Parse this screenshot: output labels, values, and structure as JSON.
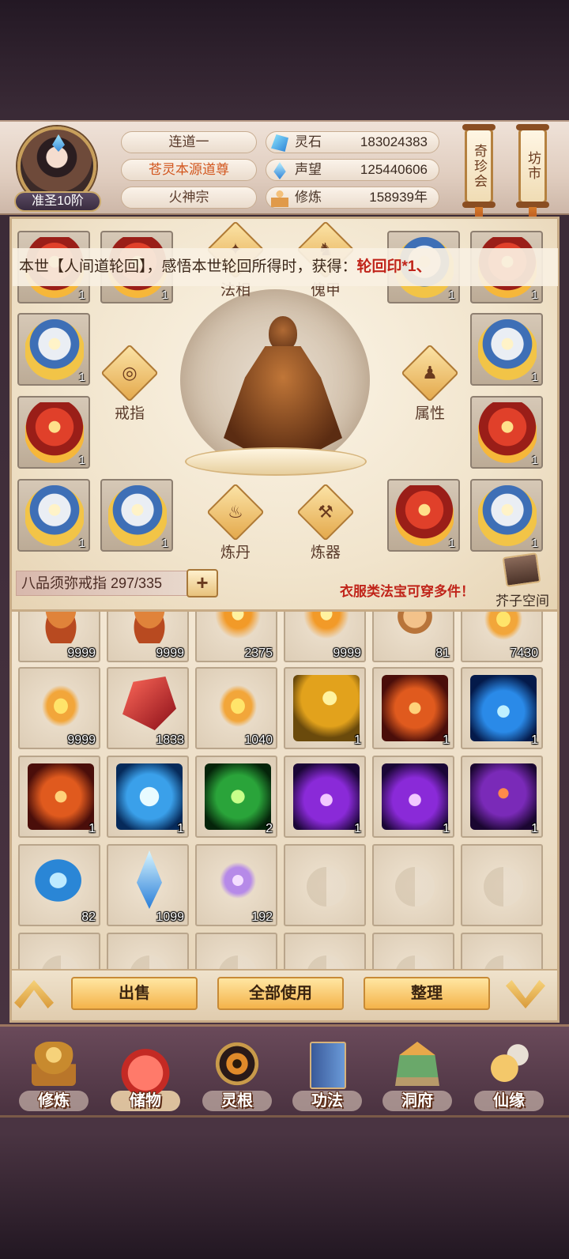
{
  "player": {
    "rank": "准圣10阶",
    "names": [
      "连道一",
      "苍灵本源道尊",
      "火神宗"
    ]
  },
  "resources": [
    {
      "label": "灵石",
      "value": "183024383",
      "icon": "spirit-stone-icon"
    },
    {
      "label": "声望",
      "value": "125440606",
      "icon": "prestige-icon"
    },
    {
      "label": "修炼",
      "value": "158939年",
      "icon": "cultivation-icon"
    }
  ],
  "top_buttons": {
    "treasure": "奇珍会",
    "market": "坊市"
  },
  "marquee": {
    "text": "本世【人间道轮回】，感悟本世轮回所得时，获得：",
    "highlight": "轮回印*1、"
  },
  "equip_functions": {
    "dharma": "法相",
    "armor": "傀甲",
    "ring": "戒指",
    "attribute": "属性",
    "alchemy": "炼丹",
    "forging": "炼器"
  },
  "equip_slots": {
    "top_left_1": "1",
    "top_left_2": "1",
    "top_right_1": "1",
    "top_right_2": "1",
    "mid1_left": "1",
    "mid1_right": "1",
    "mid2_left": "1",
    "mid2_right": "1",
    "bottom_left_1": "1",
    "bottom_left_2": "1",
    "bottom_right_1": "1",
    "bottom_right_2": "1"
  },
  "ring_bar": {
    "text": "八品须弥戒指 297/335",
    "plus": "+"
  },
  "equip_note": "衣服类法宝可穿多件！",
  "bag_button": "芥子空间",
  "inventory": [
    {
      "icon": "meat-bun-icon",
      "count": "9999"
    },
    {
      "icon": "meat-bun-icon",
      "count": "9999"
    },
    {
      "icon": "flame-orb-icon",
      "count": "2375"
    },
    {
      "icon": "flame-orb-icon",
      "count": "9999"
    },
    {
      "icon": "bronze-coin-icon",
      "count": "81"
    },
    {
      "icon": "gold-ingot-icon",
      "count": "7430"
    },
    {
      "icon": "gold-ingot-icon",
      "count": "9999"
    },
    {
      "icon": "red-crystal-icon",
      "count": "1833"
    },
    {
      "icon": "fire-ingot-icon",
      "count": "1040"
    },
    {
      "icon": "golden-warrior-skill-icon",
      "count": "1"
    },
    {
      "icon": "fire-phoenix-skill-icon",
      "count": "1"
    },
    {
      "icon": "blue-flame-skill-icon",
      "count": "1"
    },
    {
      "icon": "fire-phoenix-skill-icon",
      "count": "1"
    },
    {
      "icon": "ice-skull-skill-icon",
      "count": "1"
    },
    {
      "icon": "green-vortex-skill-icon",
      "count": "2"
    },
    {
      "icon": "purple-claw-skill-icon",
      "count": "1"
    },
    {
      "icon": "purple-orb-skill-icon",
      "count": "1"
    },
    {
      "icon": "purple-fire-claw-skill-icon",
      "count": "1"
    },
    {
      "icon": "blue-spirit-stone-icon",
      "count": "82"
    },
    {
      "icon": "blue-feather-crystal-icon",
      "count": "1099"
    },
    {
      "icon": "lavender-flower-icon",
      "count": "192"
    }
  ],
  "actions": {
    "sell": "出售",
    "use_all": "全部使用",
    "sort": "整理"
  },
  "nav": [
    {
      "label": "修炼",
      "icon": "cultivation-monk-icon"
    },
    {
      "label": "储物",
      "icon": "storage-bag-icon"
    },
    {
      "label": "灵根",
      "icon": "spirit-root-icon"
    },
    {
      "label": "功法",
      "icon": "technique-book-icon"
    },
    {
      "label": "洞府",
      "icon": "cave-mansion-icon"
    },
    {
      "label": "仙缘",
      "icon": "immortal-fate-icon"
    }
  ]
}
